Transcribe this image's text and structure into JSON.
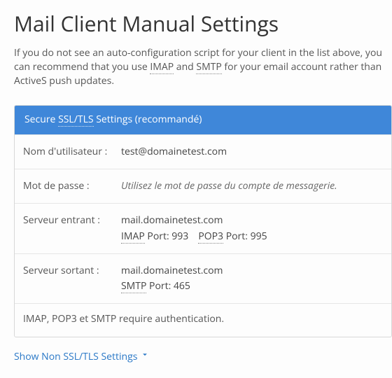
{
  "title": "Mail Client Manual Settings",
  "intro": {
    "pre": "If you do not see an auto-configuration script for your client in the list above, you can recommend that you use ",
    "imap": "IMAP",
    "mid": " and ",
    "smtp": "SMTP",
    "post": " for your email account rather than ActiveS push updates."
  },
  "panel": {
    "header": {
      "pre": "Secure ",
      "ssltls": "SSL/TLS",
      "post": " Settings (recommandé)"
    },
    "rows": {
      "username": {
        "label": "Nom d'utilisateur :",
        "value": "test@domainetest.com"
      },
      "password": {
        "label": "Mot de passe :",
        "value": "Utilisez le mot de passe du compte de messagerie."
      },
      "incoming": {
        "label": "Serveur entrant :",
        "server": "mail.domainetest.com",
        "imap_abbr": "IMAP",
        "imap_port_label": " Port: ",
        "imap_port": "993",
        "pop3_abbr": "POP3",
        "pop3_port_label": " Port: ",
        "pop3_port": "995"
      },
      "outgoing": {
        "label": "Serveur sortant :",
        "server": "mail.domainetest.com",
        "smtp_abbr": "SMTP",
        "smtp_port_label": " Port: ",
        "smtp_port": "465"
      }
    },
    "auth_note": "IMAP, POP3 et SMTP require authentication."
  },
  "toggle": {
    "label": "Show Non SSL/TLS Settings"
  }
}
